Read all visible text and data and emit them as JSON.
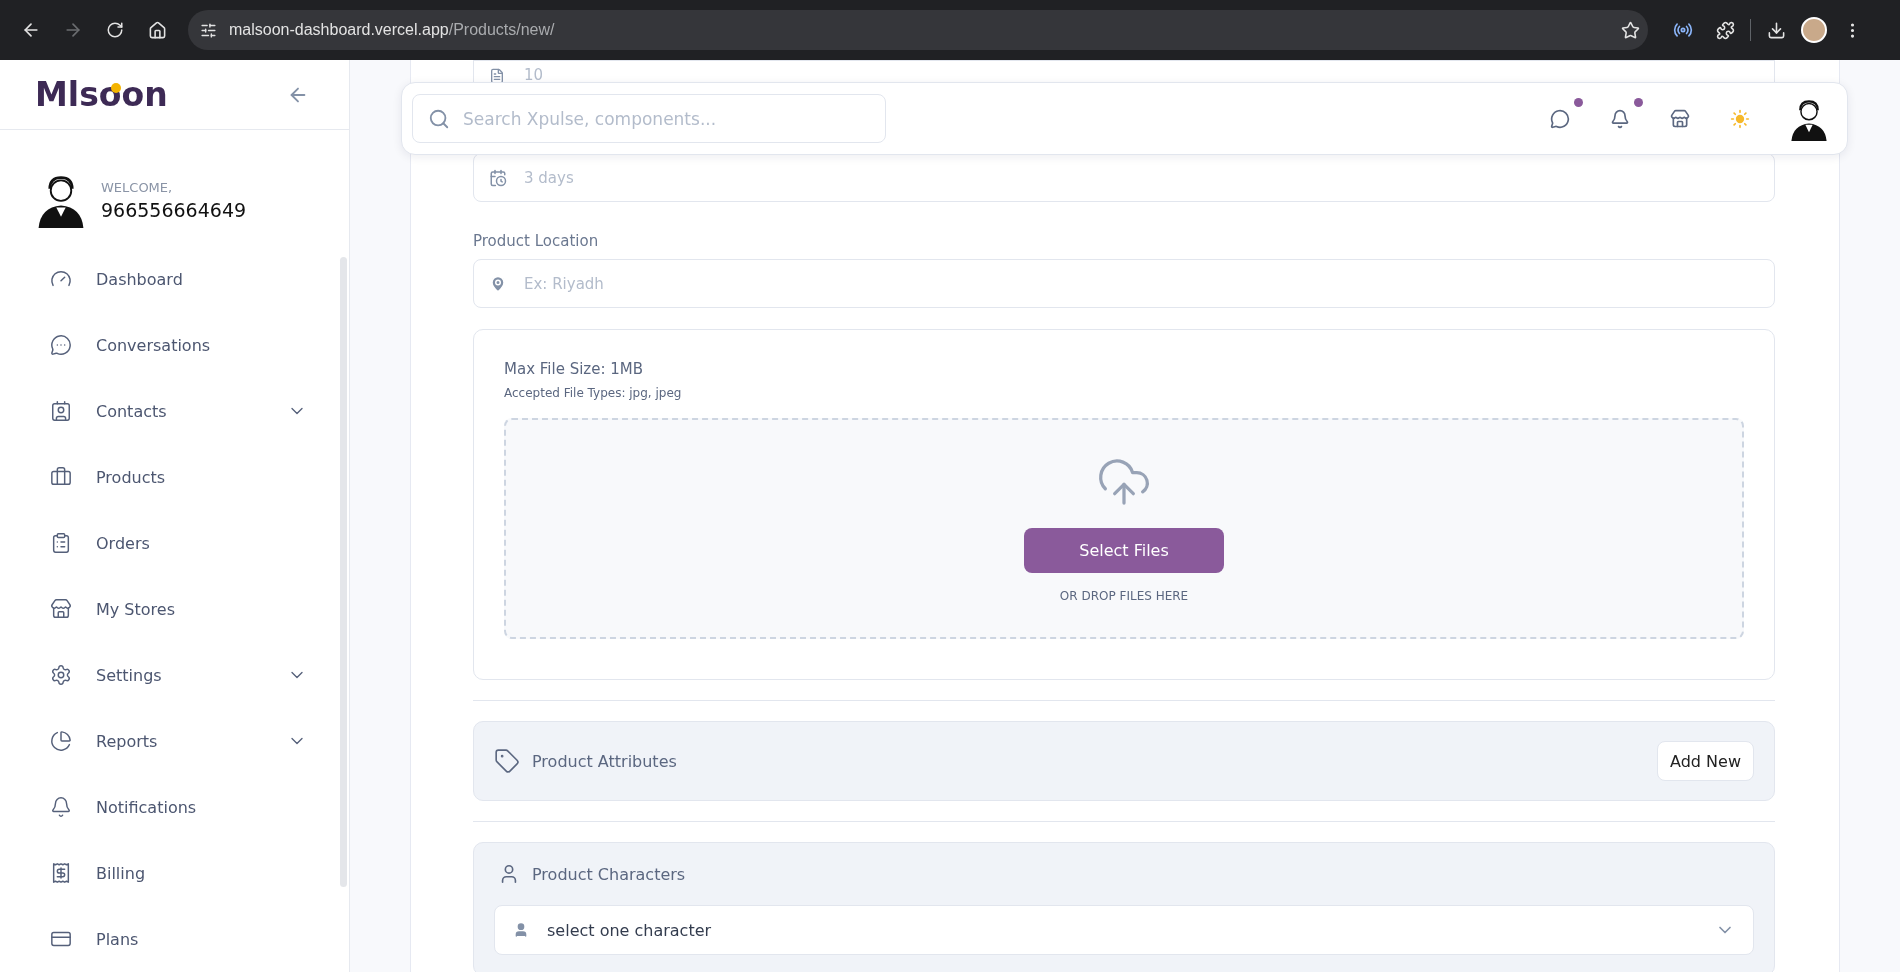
{
  "browser": {
    "url_host": "malsoon-dashboard.vercel.app",
    "url_path": "/Products/new/",
    "forward_disabled": true
  },
  "sidebar": {
    "logo": "Mlsoon",
    "welcome": "WELCOME,",
    "user": "966556664649",
    "items": [
      {
        "kind": "dashboard",
        "label": "Dashboard",
        "has_submenu": false
      },
      {
        "kind": "chat",
        "label": "Conversations",
        "has_submenu": false
      },
      {
        "kind": "contacts",
        "label": "Contacts",
        "has_submenu": true
      },
      {
        "kind": "products",
        "label": "Products",
        "has_submenu": false
      },
      {
        "kind": "orders",
        "label": "Orders",
        "has_submenu": false
      },
      {
        "kind": "stores",
        "label": "My Stores",
        "has_submenu": false
      },
      {
        "kind": "settings",
        "label": "Settings",
        "has_submenu": true
      },
      {
        "kind": "reports",
        "label": "Reports",
        "has_submenu": true
      },
      {
        "kind": "notifications",
        "label": "Notifications",
        "has_submenu": false
      },
      {
        "kind": "billing",
        "label": "Billing",
        "has_submenu": false
      },
      {
        "kind": "plans",
        "label": "Plans",
        "has_submenu": false
      }
    ]
  },
  "header": {
    "search": {
      "placeholder": "Search Xpulse, components..."
    },
    "icons": [
      {
        "kind": "chat",
        "unread": true
      },
      {
        "kind": "bell",
        "unread": true
      },
      {
        "kind": "store"
      },
      {
        "kind": "sun"
      }
    ]
  },
  "form": {
    "quantity_field": {
      "placeholder": "10"
    },
    "duration_field": {
      "placeholder": "3 days"
    },
    "location": {
      "label": "Product Location",
      "placeholder": "Ex: Riyadh"
    },
    "upload": {
      "max_size": "Max File Size: 1MB",
      "types": "Accepted File Types: jpg, jpeg",
      "button": "Select Files",
      "hint": "OR DROP FILES HERE"
    },
    "attributes": {
      "title": "Product Attributes",
      "button": "Add New"
    },
    "characters": {
      "title": "Product Characters",
      "select_placeholder": "select one character"
    }
  }
}
